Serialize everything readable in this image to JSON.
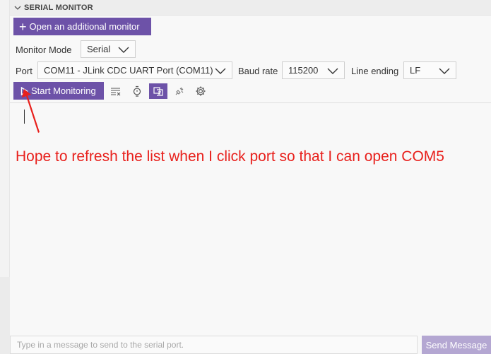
{
  "panel": {
    "title": "SERIAL MONITOR"
  },
  "toolbar": {
    "open_monitor_label": "Open an additional monitor",
    "start_label": "Start Monitoring"
  },
  "monitor_mode": {
    "label": "Monitor Mode",
    "value": "Serial"
  },
  "port": {
    "label": "Port",
    "value": "COM11 - JLink CDC UART Port (COM11)"
  },
  "baud_rate": {
    "label": "Baud rate",
    "value": "115200"
  },
  "line_ending": {
    "label": "Line ending",
    "value": "LF"
  },
  "annotation": {
    "text": "Hope to refresh the list when I click port so that I can open COM5"
  },
  "message": {
    "placeholder": "Type in a message to send to the serial port.",
    "send_label": "Send Message"
  },
  "icons": [
    "chevron-down-icon",
    "plus-icon",
    "play-icon",
    "clear-output-icon",
    "timestamp-icon",
    "toggle-terminal-icon",
    "plug-icon",
    "gear-icon"
  ],
  "colors": {
    "accent": "#6d52a8",
    "accent_disabled": "#b4a7d2",
    "annotation": "#e8201c"
  }
}
